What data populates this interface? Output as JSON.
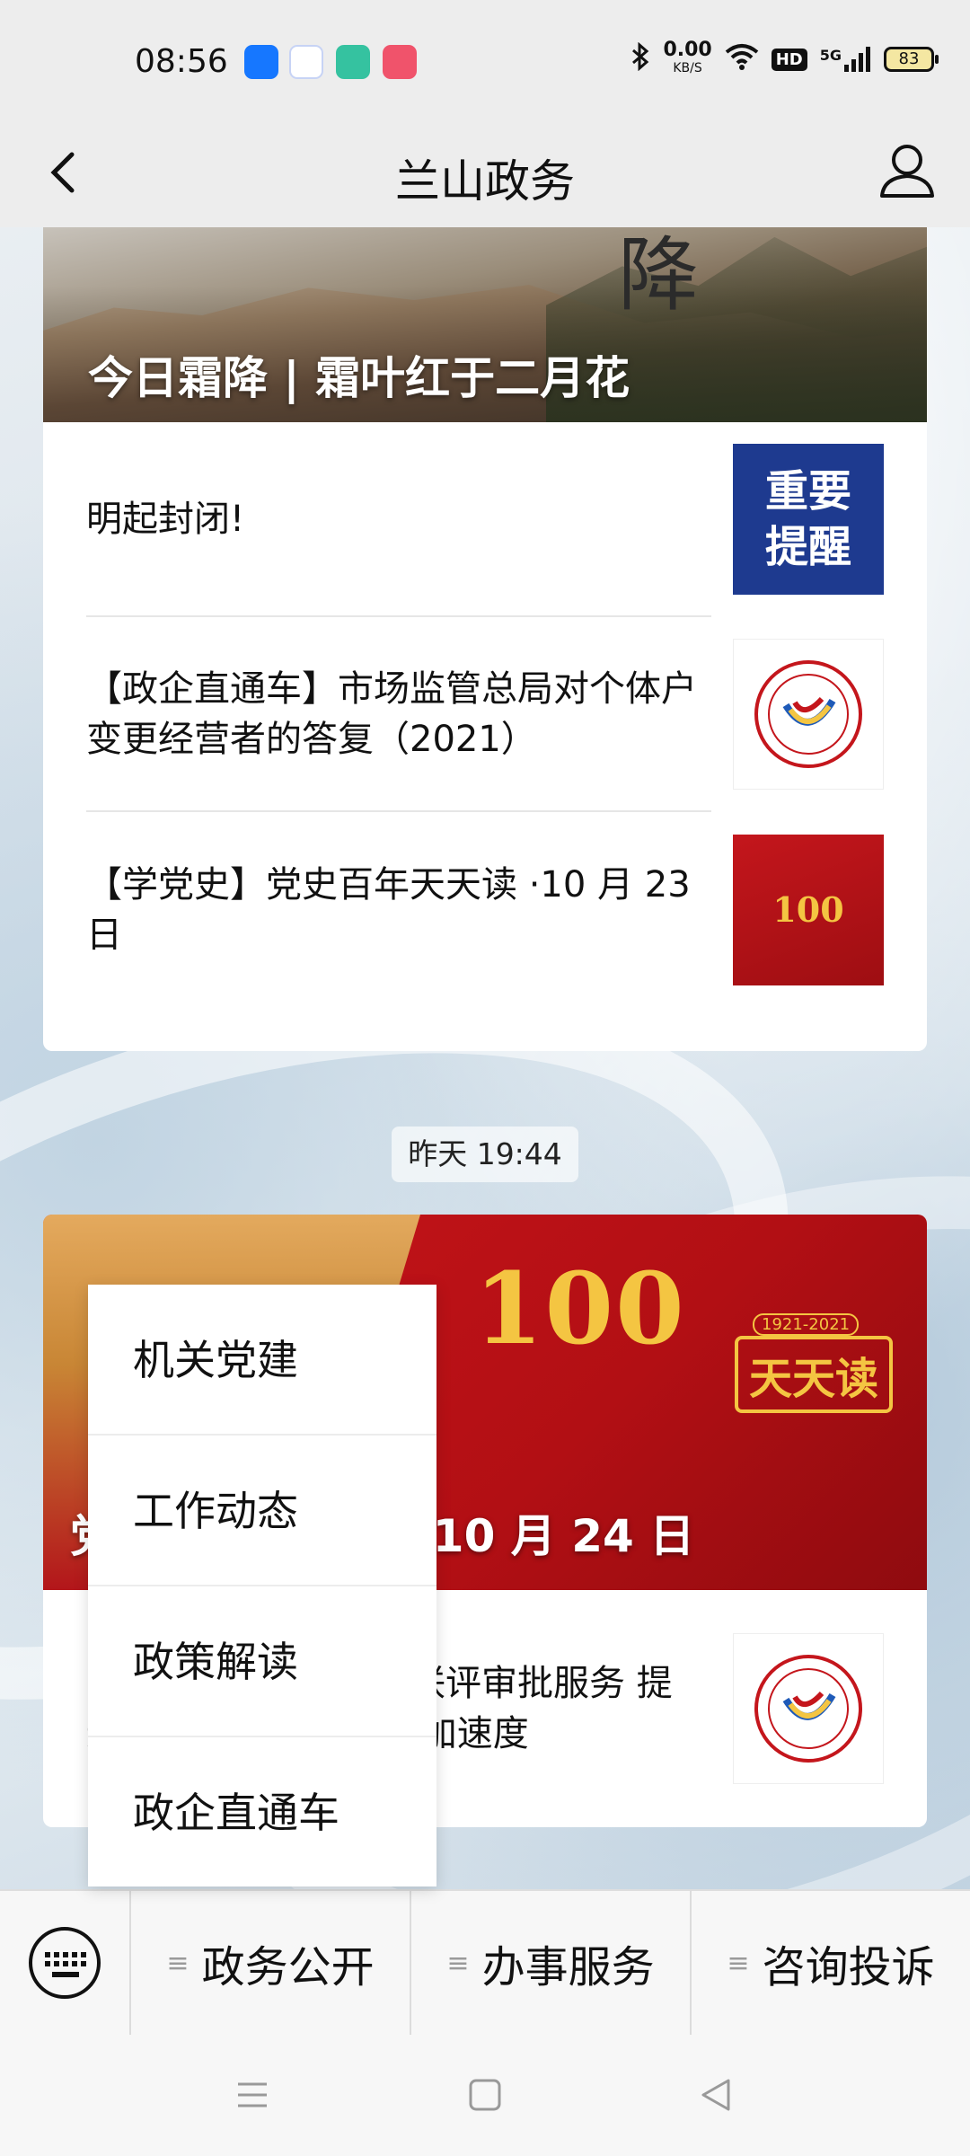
{
  "status_bar": {
    "time": "08:56",
    "net_speed_value": "0.00",
    "net_speed_unit": "KB/S",
    "hd_label": "HD",
    "network": "5G",
    "battery": "83"
  },
  "header": {
    "title": "兰山政务"
  },
  "messages": [
    {
      "cover_title": "今日霜降 | 霜叶红于二月花",
      "articles": [
        {
          "title": "明起封闭!",
          "thumb_text_1": "重要",
          "thumb_text_2": "提醒"
        },
        {
          "title": "【政企直通车】市场监管总局对个体户变更经营者的答复（2021）"
        },
        {
          "title": "【学党史】党史百年天天读 ·10 月 23 日",
          "thumb_text": "100"
        }
      ]
    },
    {
      "timestamp": "昨天 19:44",
      "cover_title": "党史百年天天读 · 10 月 24 日",
      "cover_art": {
        "hundred": "100",
        "daily": "天天读",
        "years": "1921-2021"
      },
      "articles": [
        {
          "title": "兰山区推行工程项目联评审批服务 提速项目落地 跑出兰山加速度"
        }
      ]
    }
  ],
  "popup_menu": {
    "items": [
      "机关党建",
      "工作动态",
      "政策解读",
      "政企直通车"
    ]
  },
  "bottom_menu": {
    "tabs": [
      "政务公开",
      "办事服务",
      "咨询投诉"
    ]
  },
  "colors": {
    "header_bg": "#ededed",
    "reminder_blue": "#1e3a8f",
    "party_red": "#c4161c",
    "gold": "#f4c542"
  }
}
